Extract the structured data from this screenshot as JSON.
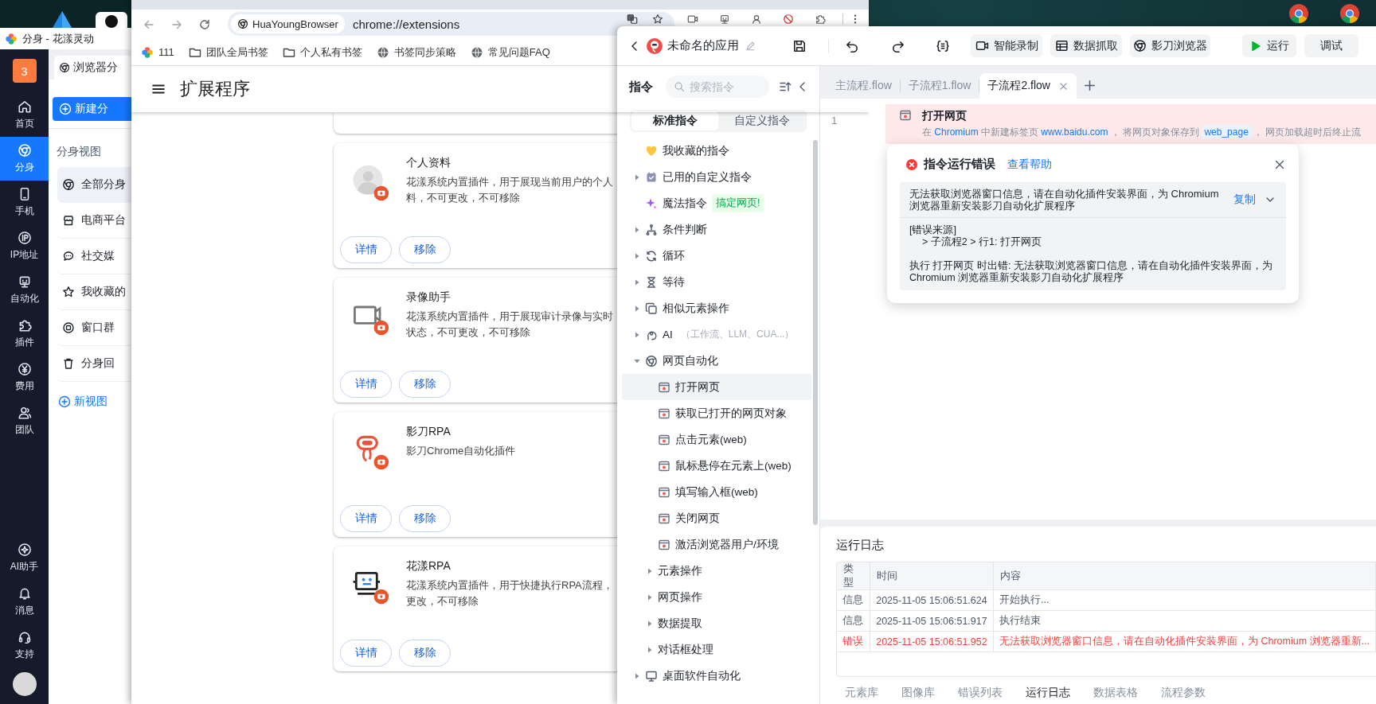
{
  "left_app": {
    "title": "分身 - 花漾灵动",
    "badge": "3",
    "nav": [
      {
        "label": "首页",
        "selected": false
      },
      {
        "label": "分身",
        "selected": true
      },
      {
        "label": "手机",
        "selected": false
      },
      {
        "label": "IP地址",
        "selected": false
      },
      {
        "label": "自动化",
        "selected": false
      },
      {
        "label": "插件",
        "selected": false
      },
      {
        "label": "费用",
        "selected": false
      },
      {
        "label": "团队",
        "selected": false
      }
    ],
    "nav_bottom": [
      "AI助手",
      "消息",
      "支持"
    ],
    "tab": "浏览器分",
    "new_button": "新建分",
    "views_title": "分身视图",
    "views": [
      {
        "label": "全部分身",
        "selected": true
      },
      {
        "label": "电商平台",
        "selected": false
      },
      {
        "label": "社交媒",
        "selected": false
      },
      {
        "label": "我收藏的",
        "selected": false
      },
      {
        "label": "窗口群",
        "selected": false
      },
      {
        "label": "分身回",
        "selected": false
      }
    ],
    "new_view": "新视图"
  },
  "browser": {
    "site_chip": "HuaYoungBrowser",
    "url": "chrome://extensions",
    "bookmarks": [
      {
        "label": "111",
        "kind": "app"
      },
      {
        "label": "团队全局书签",
        "kind": "folder"
      },
      {
        "label": "个人私有书签",
        "kind": "folder"
      },
      {
        "label": "书签同步策略",
        "kind": "site"
      },
      {
        "label": "常见问题FAQ",
        "kind": "site"
      }
    ],
    "page_title": "扩展程序",
    "extensions": [
      {
        "name": "个人资料",
        "description_lines": [
          "花漾系统内置插件，用于展现当前用户的个人",
          "料，不可更改，不可移除"
        ],
        "buttons": [
          "详情",
          "移除"
        ]
      },
      {
        "name": "录像助手",
        "description_lines": [
          "花漾系统内置插件，用于展现审计录像与实时",
          "状态，不可更改，不可移除"
        ],
        "buttons": [
          "详情",
          "移除"
        ]
      },
      {
        "name": "影刀RPA",
        "description_lines": [
          "影刀Chrome自动化插件"
        ],
        "buttons": [
          "详情",
          "移除"
        ]
      },
      {
        "name": "花漾RPA",
        "description_lines": [
          "花漾系统内置插件，用于快捷执行RPA流程，",
          "更改，不可移除"
        ],
        "buttons": [
          "详情",
          "移除"
        ]
      }
    ]
  },
  "rpa": {
    "app_name": "未命名的应用",
    "toolbar_buttons": [
      "智能录制",
      "数据抓取",
      "影刀浏览器"
    ],
    "run": "运行",
    "debug": "调试",
    "panel_title": "指令",
    "search": {
      "placeholder": "搜索指令"
    },
    "modes": [
      {
        "label": "标准指令",
        "selected": true
      },
      {
        "label": "自定义指令",
        "selected": false
      }
    ],
    "commands": [
      {
        "label": "我收藏的指令",
        "kind": "favorite"
      },
      {
        "label": "已用的自定义指令",
        "kind": "group",
        "expanded": false
      },
      {
        "label": "魔法指令",
        "kind": "magic",
        "badge": "搞定网页!"
      },
      {
        "label": "条件判断",
        "kind": "group",
        "expanded": false
      },
      {
        "label": "循环",
        "kind": "group",
        "expanded": false
      },
      {
        "label": "等待",
        "kind": "group",
        "expanded": false
      },
      {
        "label": "相似元素操作",
        "kind": "group",
        "expanded": false
      },
      {
        "label": "AI",
        "kind": "group",
        "expanded": false,
        "hint": "（工作流、LLM、CUA...）"
      },
      {
        "label": "网页自动化",
        "kind": "group",
        "expanded": true,
        "children": [
          {
            "label": "打开网页",
            "kind": "command",
            "selected": true
          },
          {
            "label": "获取已打开的网页对象",
            "kind": "command",
            "selected": false
          },
          {
            "label": "点击元素(web)",
            "kind": "command",
            "selected": false
          },
          {
            "label": "鼠标悬停在元素上(web)",
            "kind": "command",
            "selected": false
          },
          {
            "label": "填写输入框(web)",
            "kind": "command",
            "selected": false
          },
          {
            "label": "关闭网页",
            "kind": "command",
            "selected": false
          },
          {
            "label": "激活浏览器用户/环境",
            "kind": "command",
            "selected": false
          },
          {
            "label": "元素操作",
            "kind": "group",
            "expanded": false
          },
          {
            "label": "网页操作",
            "kind": "group",
            "expanded": false
          },
          {
            "label": "数据提取",
            "kind": "group",
            "expanded": false
          },
          {
            "label": "对话框处理",
            "kind": "group",
            "expanded": false
          }
        ]
      },
      {
        "label": "桌面软件自动化",
        "kind": "group",
        "expanded": false
      }
    ],
    "tabs": [
      {
        "label": "主流程.flow",
        "selected": false
      },
      {
        "label": "子流程1.flow",
        "selected": false
      },
      {
        "label": "子流程2.flow",
        "selected": true
      }
    ],
    "flow": [
      {
        "line": "1",
        "title": "打开网页",
        "error": true,
        "description": [
          {
            "kind": "text",
            "text": "在 "
          },
          {
            "kind": "value",
            "text": "Chromium"
          },
          {
            "kind": "text",
            "text": " 中新建标签页 "
          },
          {
            "kind": "value",
            "text": "www.baidu.com"
          },
          {
            "kind": "text",
            "text": " ， 将网页对象保存到 "
          },
          {
            "kind": "variable",
            "text": "web_page"
          },
          {
            "kind": "text",
            "text": " ， 网页加载超时后终止流"
          }
        ]
      }
    ],
    "error_popup": {
      "title": "指令运行错误",
      "help_link": "查看帮助",
      "message": "无法获取浏览器窗口信息，请在自动化插件安装界面，为 Chromium 浏览器重新安装影刀自动化扩展程序",
      "copy": "复制",
      "source_title": "[错误来源]",
      "source_path": "> 子流程2 > 行1: 打开网页",
      "detail": "执行 打开网页 时出错: 无法获取浏览器窗口信息，请在自动化插件安装界面，为 Chromium 浏览器重新安装影刀自动化扩展程序"
    },
    "log": {
      "title": "运行日志",
      "columns": [
        "类型",
        "时间",
        "内容"
      ],
      "rows": [
        {
          "kind": "info",
          "type": "信息",
          "time": "2025-11-05 15:06:51.624",
          "content": "开始执行..."
        },
        {
          "kind": "info",
          "type": "信息",
          "time": "2025-11-05 15:06:51.917",
          "content": "执行结束"
        },
        {
          "kind": "error",
          "type": "错误",
          "time": "2025-11-05 15:06:51.952",
          "content": "无法获取浏览器窗口信息，请在自动化插件安装界面，为 Chromium 浏览器重新..."
        }
      ]
    },
    "bottom_tabs": [
      {
        "label": "元素库",
        "selected": false
      },
      {
        "label": "图像库",
        "selected": false
      },
      {
        "label": "错误列表",
        "selected": false
      },
      {
        "label": "运行日志",
        "selected": true
      },
      {
        "label": "数据表格",
        "selected": false
      },
      {
        "label": "流程参数",
        "selected": false
      }
    ]
  }
}
